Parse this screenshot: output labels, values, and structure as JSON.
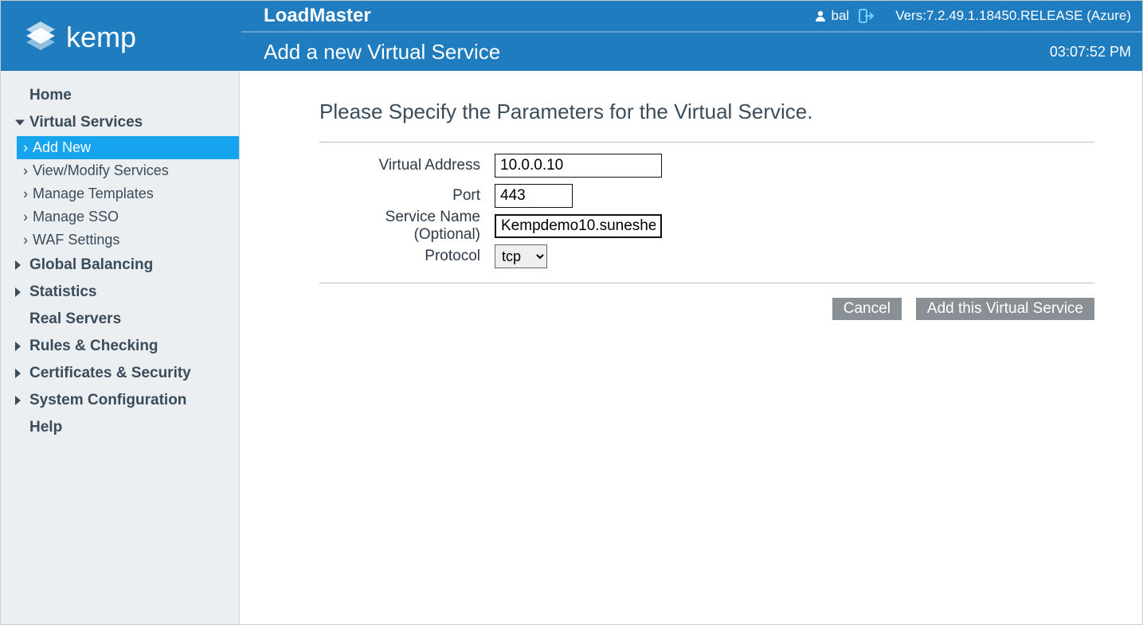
{
  "header": {
    "product": "LoadMaster",
    "username": "bal",
    "version": "Vers:7.2.49.1.18450.RELEASE (Azure)",
    "page_title": "Add a new Virtual Service",
    "time": "03:07:52 PM"
  },
  "sidebar": {
    "home": "Home",
    "virtual_services": "Virtual Services",
    "vs_items": {
      "add_new": "Add New",
      "view_modify": "View/Modify Services",
      "manage_templates": "Manage Templates",
      "manage_sso": "Manage SSO",
      "waf_settings": "WAF Settings"
    },
    "global_balancing": "Global Balancing",
    "statistics": "Statistics",
    "real_servers": "Real Servers",
    "rules_checking": "Rules & Checking",
    "certificates_security": "Certificates & Security",
    "system_configuration": "System Configuration",
    "help": "Help"
  },
  "form": {
    "heading": "Please Specify the Parameters for the Virtual Service.",
    "labels": {
      "virtual_address": "Virtual Address",
      "port": "Port",
      "service_name": "Service Name (Optional)",
      "protocol": "Protocol"
    },
    "values": {
      "virtual_address": "10.0.0.10",
      "port": "443",
      "service_name": "Kempdemo10.suneshe",
      "protocol": "tcp"
    },
    "buttons": {
      "cancel": "Cancel",
      "submit": "Add this Virtual Service"
    }
  }
}
